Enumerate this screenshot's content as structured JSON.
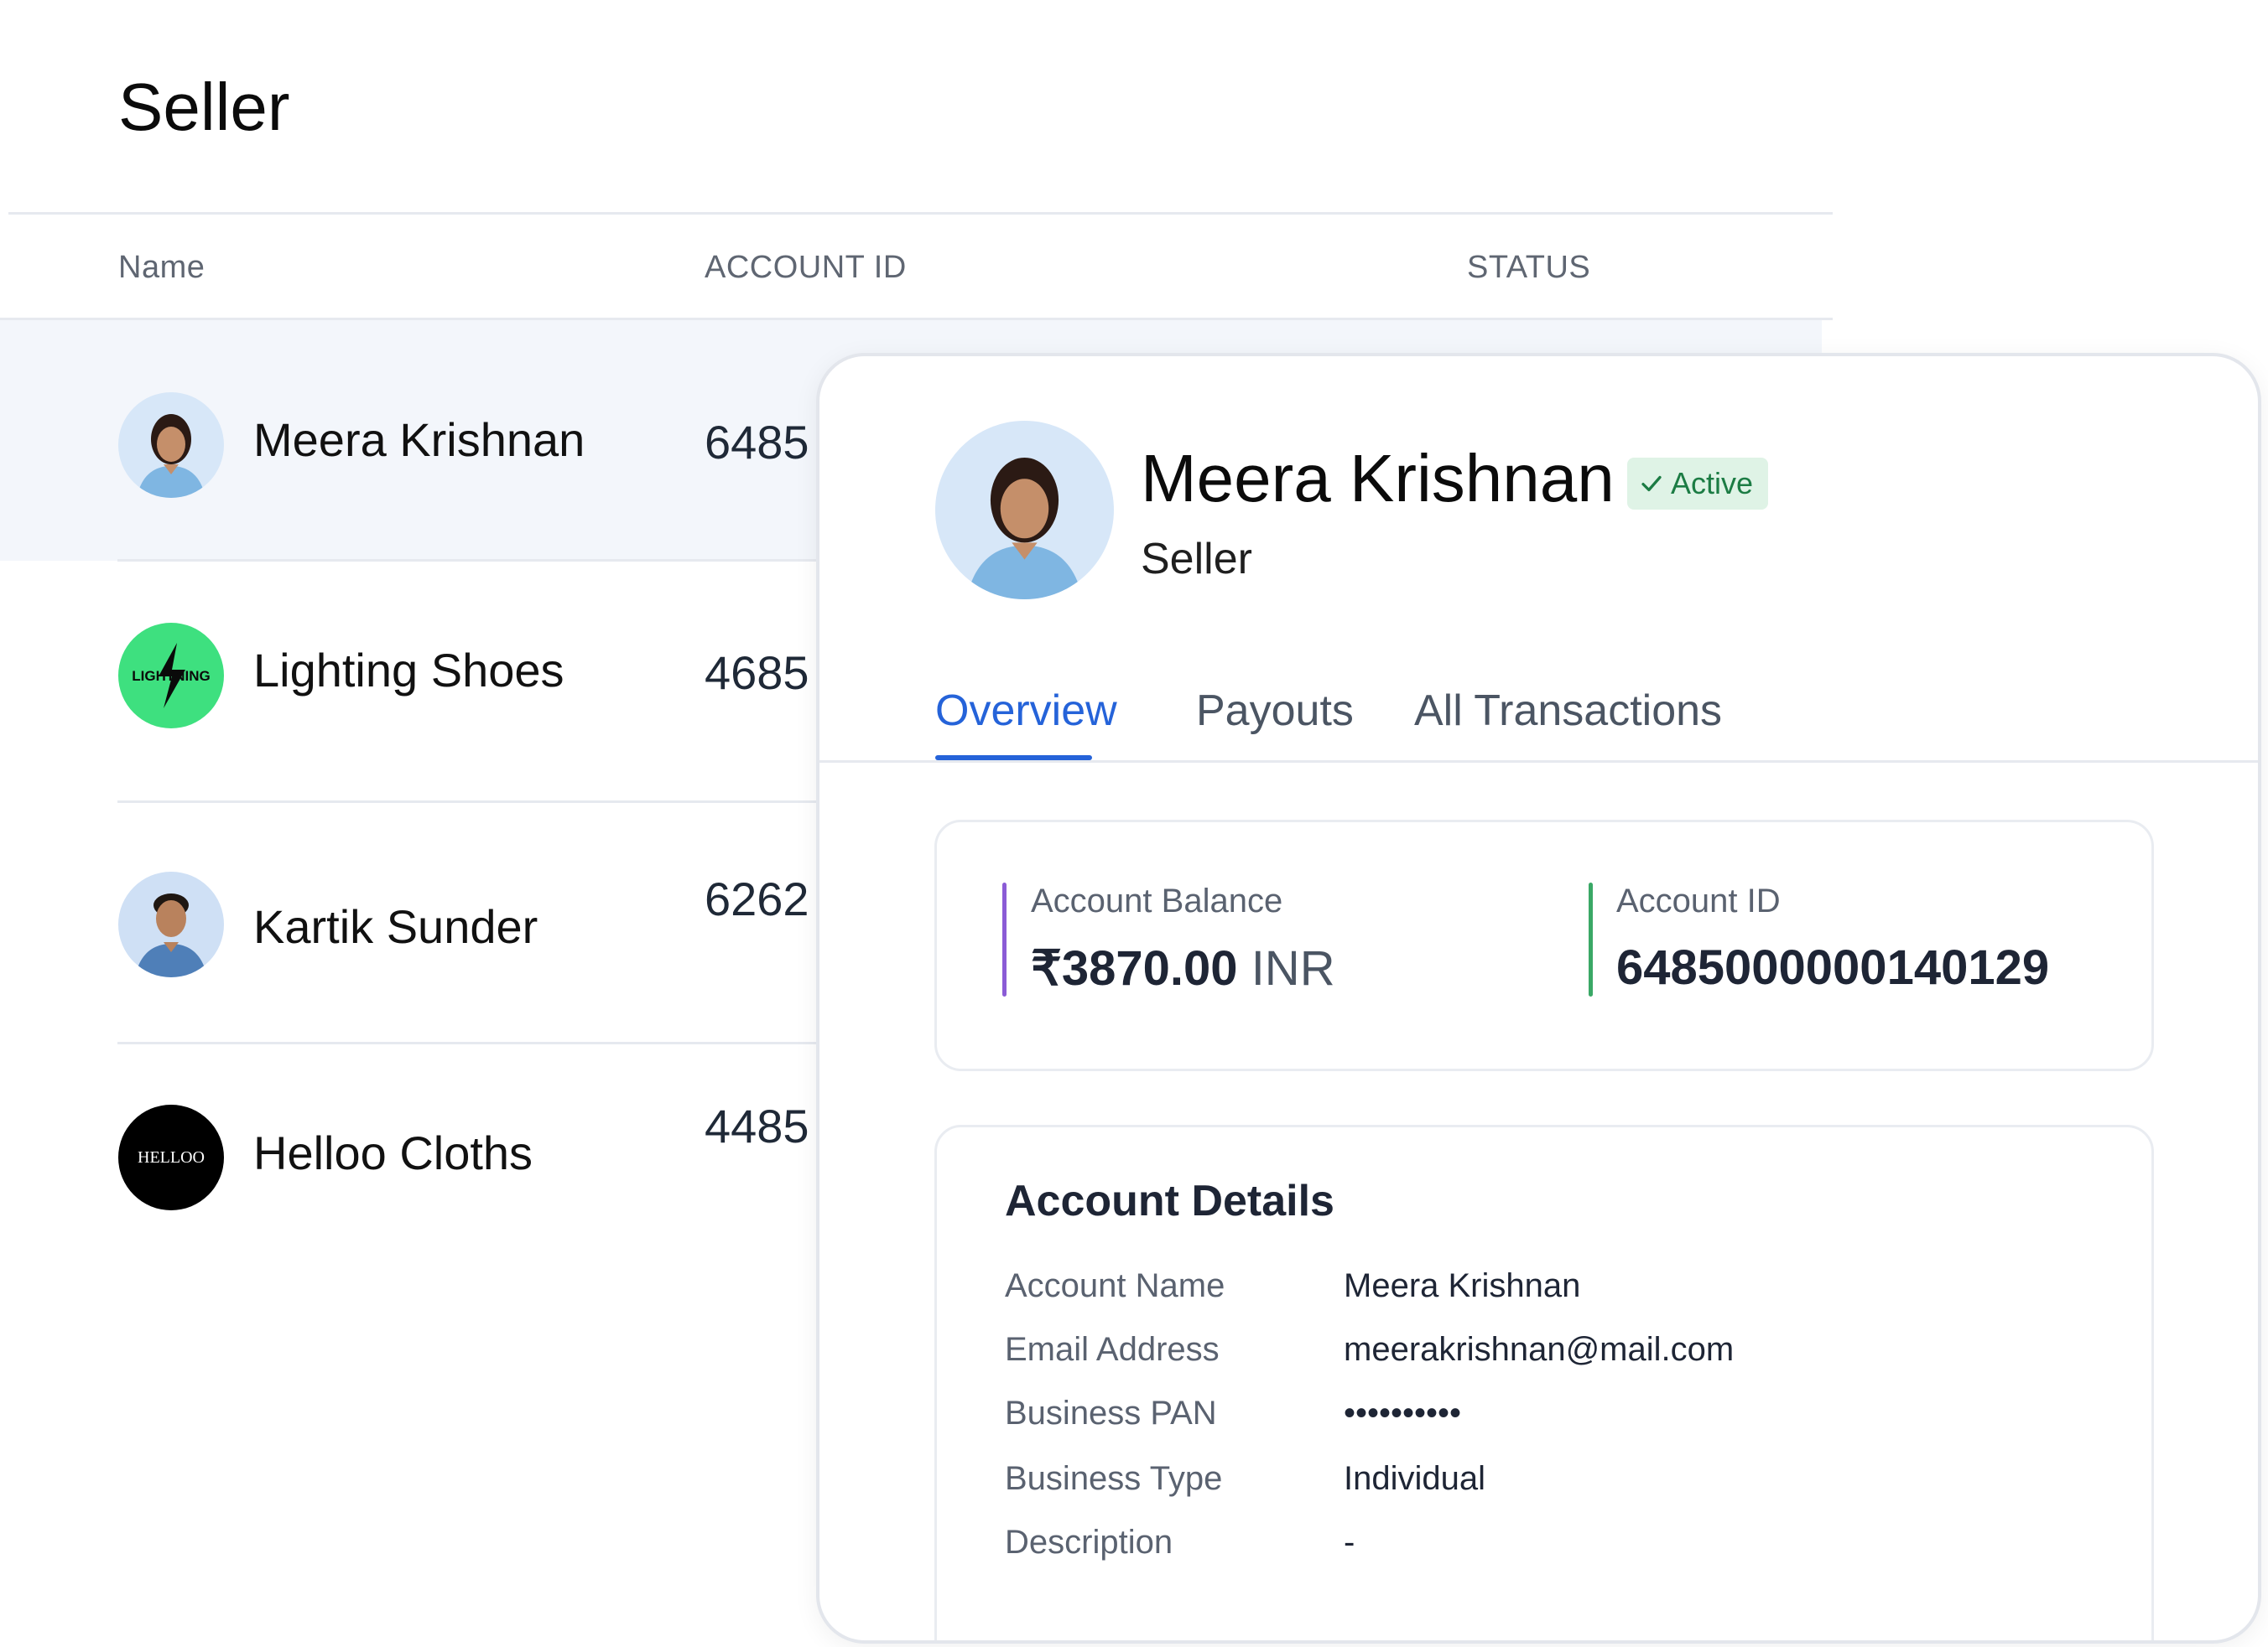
{
  "page": {
    "title": "Seller"
  },
  "table": {
    "columns": [
      "Name",
      "ACCOUNT ID",
      "STATUS"
    ],
    "rows": [
      {
        "name": "Meera Krishnan",
        "account_id": "6485",
        "avatar": "woman-portrait-icon"
      },
      {
        "name": "Lighting Shoes",
        "account_id": "4685",
        "avatar": "lightning-logo-icon",
        "logo_text": "LIGHTNING",
        "logo_color": "#3ee07f"
      },
      {
        "name": "Kartik Sunder",
        "account_id": "6262",
        "avatar": "man-portrait-icon"
      },
      {
        "name": "Helloo Cloths",
        "account_id": "4485",
        "avatar": "helloo-logo-icon",
        "logo_text": "HELLOO",
        "logo_color": "#000000"
      }
    ]
  },
  "detail": {
    "name": "Meera Krishnan",
    "status": "Active",
    "role": "Seller",
    "tabs": [
      "Overview",
      "Payouts",
      "All Transactions"
    ],
    "active_tab": "Overview",
    "summary": {
      "balance_label": "Account Balance",
      "balance_amount": "₹3870.00",
      "balance_currency": "INR",
      "id_label": "Account ID",
      "id_value": "6485000000140129"
    },
    "account_details": {
      "title": "Account Details",
      "fields": [
        {
          "label": "Account Name",
          "value": "Meera Krishnan"
        },
        {
          "label": "Email Address",
          "value": "meerakrishnan@mail.com"
        },
        {
          "label": "Business PAN",
          "value": "••••••••••"
        },
        {
          "label": "Business Type",
          "value": "Individual"
        },
        {
          "label": "Description",
          "value": "-"
        }
      ]
    }
  },
  "colors": {
    "accent": "#2563d9",
    "active_badge_bg": "#dff3e6",
    "active_badge_text": "#1c7c44",
    "balance_bar": "#8b5cd6",
    "id_bar": "#3aa866",
    "selected_row_bg": "#f3f6fb"
  }
}
